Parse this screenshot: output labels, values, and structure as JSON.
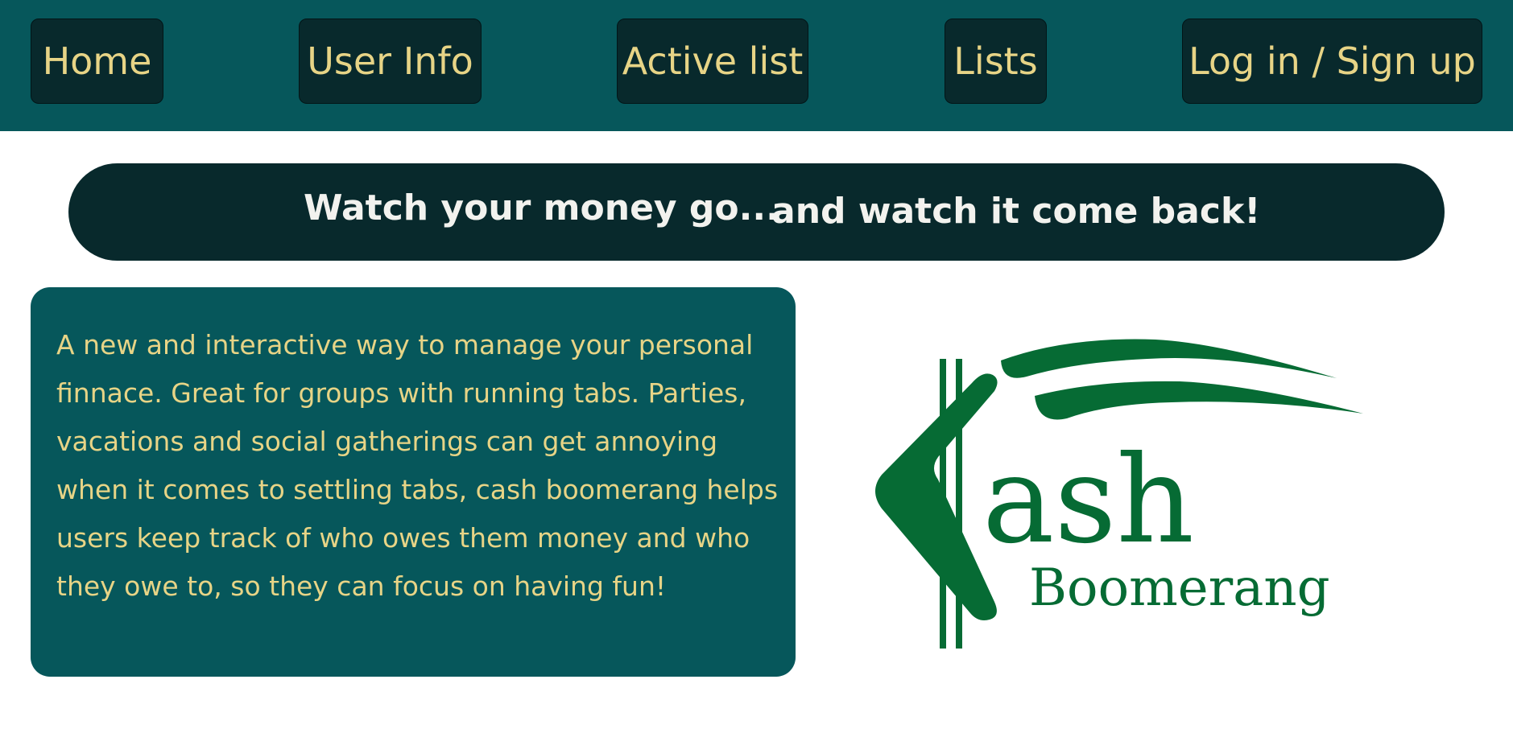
{
  "nav": {
    "home": "Home",
    "user_info": "User Info",
    "active_list": "Active list",
    "lists": "Lists",
    "login": "Log in / Sign up"
  },
  "banner": {
    "part1": "Watch your money go...",
    "part2": "and watch it come back!"
  },
  "description": "A new and interactive way to manage your personal finnace. Great for groups with running tabs. Parties, vacations and social gatherings can get annoying when it comes to settling tabs, cash boomerang helps users keep track of who owes them money and who they owe to, so they can focus on having fun!",
  "logo": {
    "word1": "ash",
    "word2": "Boomerang",
    "color": "#066b34"
  },
  "colors": {
    "nav_bg": "#06575b",
    "button_bg": "#08292c",
    "button_text": "#e7d486",
    "banner_text": "#f2f2ee"
  }
}
